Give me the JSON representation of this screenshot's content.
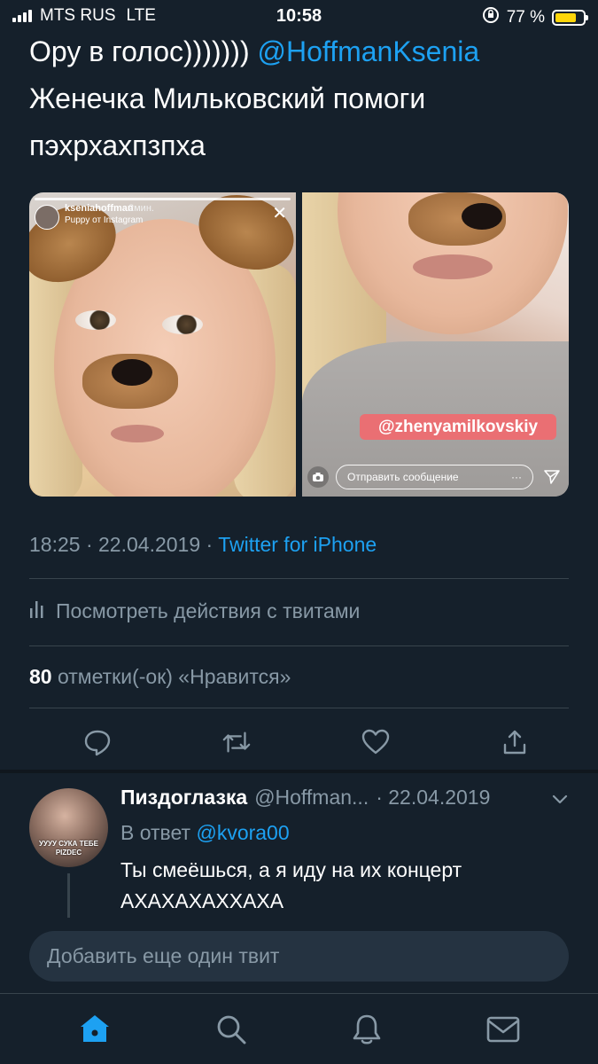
{
  "status_bar": {
    "carrier": "MTS RUS",
    "network": "LTE",
    "time": "10:58",
    "battery": "77 %",
    "battery_level": 0.77,
    "battery_color": "#ffd60a"
  },
  "tweet": {
    "text_main": "Ору в голос))))))) ",
    "mention": "@HoffmanKsenia",
    "text_rest": "Женечка Мильковский помоги пэхрхахпзпха",
    "media": {
      "image1": {
        "story_user": "kseniahoffman",
        "story_time": "2мин.",
        "story_filter": "Puppy от Instagram"
      },
      "image2": {
        "sticker": "@zhenyamilkovskiy",
        "message_placeholder": "Отправить сообщение",
        "more": "···"
      }
    },
    "time": "18:25",
    "date": "22.04.2019",
    "separator": "·",
    "source": "Twitter for iPhone",
    "activity_label": "Посмотреть действия с твитами",
    "likes_count": "80",
    "likes_label": " отметки(-ок) «Нравится»"
  },
  "actions": {
    "icons": [
      "reply-icon",
      "retweet-icon",
      "like-icon",
      "share-icon"
    ]
  },
  "reply": {
    "name": "Пиздоглазка",
    "handle": "@Hoffman...",
    "date": "· 22.04.2019",
    "reply_to_prefix": "В ответ ",
    "reply_to_handle": "@kvora00",
    "text": "Ты смеёшься, а я иду на их концерт АХАХАХАХХАХА",
    "avatar_caption": "УУУУ СУКА ТЕБЕ PIZDEC"
  },
  "compose": {
    "placeholder": "Добавить еще один твит"
  },
  "tab_bar": {
    "tabs": [
      "home-icon",
      "search-icon",
      "notifications-icon",
      "messages-icon"
    ],
    "active_color": "#1da1f2"
  }
}
